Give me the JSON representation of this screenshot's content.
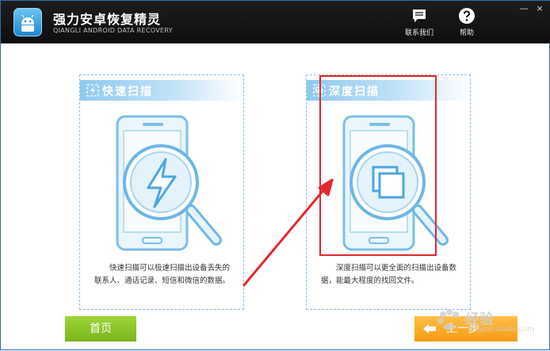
{
  "app": {
    "title": "强力安卓恢复精灵",
    "subtitle": "QIANGLI ANDROID DATA RECOVERY",
    "icon": "android-logo"
  },
  "topbar": {
    "contact_label": "联系我们",
    "contact_icon": "chat-bubble-icon",
    "help_label": "帮助",
    "help_icon": "question-icon"
  },
  "window": {
    "minimize": "—",
    "close": "×"
  },
  "panels": [
    {
      "title": "快速扫描",
      "icon": "lightning-icon",
      "description": "快速扫描可以极速扫描出设备丢失的联系人、通话记录、短信和微信的数据。"
    },
    {
      "title": "深度扫描",
      "icon": "layers-icon",
      "description": "深度扫描可以更全面的扫描出设备数据，能最大程度的找回文件。"
    }
  ],
  "buttons": {
    "home": "首页",
    "prev": "上一步"
  },
  "watermark": {
    "text": "经验",
    "url": "jingyan.baidu.com"
  },
  "colors": {
    "titlebar": "#141414",
    "panel_head": "#8ec9ef",
    "home_button": "#8cc42a",
    "prev_button": "#f5a623",
    "highlight": "#e3282d",
    "illustration": "#6eb6e6"
  }
}
